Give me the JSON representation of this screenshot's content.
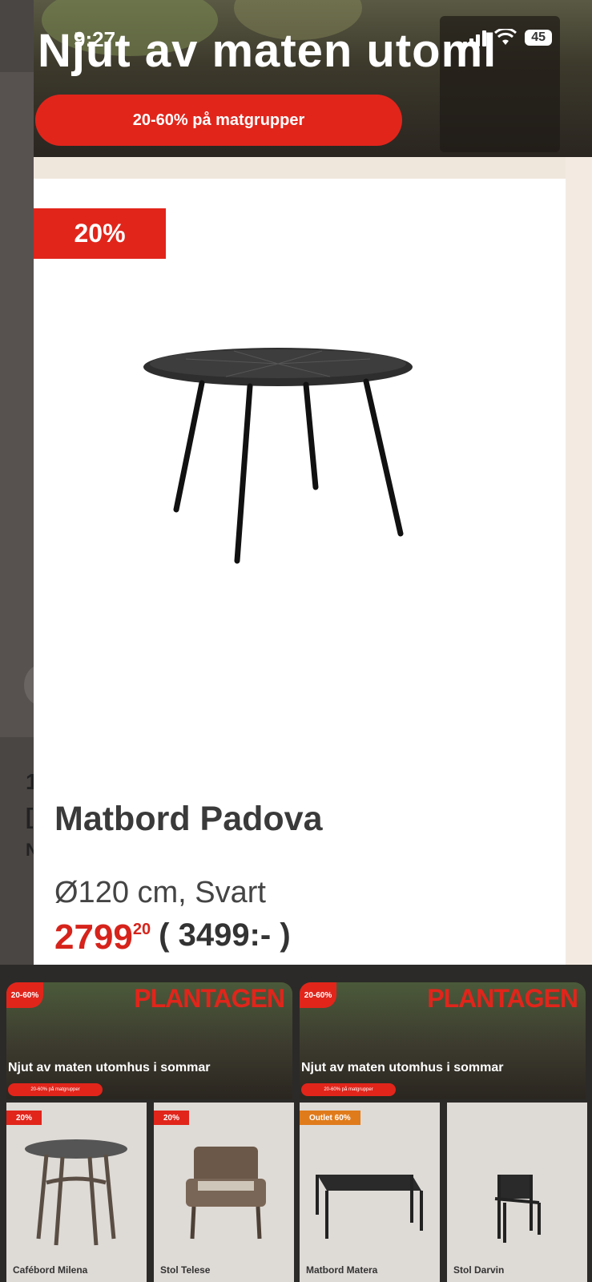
{
  "status_bar": {
    "time": "9:27",
    "battery": "45"
  },
  "banner": {
    "headline": "Njut av maten utoml",
    "promo_pill": "20-60% på matgrupper"
  },
  "product_card": {
    "discount_badge": "20%",
    "name": "Matbord Padova",
    "spec": "Ø120 cm, Svart",
    "price_main": "2799",
    "price_cents": "20",
    "price_old": "( 3499:- )"
  },
  "background_fragments": [
    "1",
    "[",
    "N"
  ],
  "promo_tiles": [
    {
      "badge": "20-60%",
      "brand": "PLANTAGEN",
      "headline": "Njut av maten utomhus i sommar",
      "pill": "20-60% på matgrupper"
    },
    {
      "badge": "20-60%",
      "brand": "PLANTAGEN",
      "headline": "Njut av maten utomhus i sommar",
      "pill": "20-60% på matgrupper"
    }
  ],
  "product_tiles": [
    {
      "badge": "20%",
      "badge_color": "#e1251b",
      "name": "Cafébord Milena"
    },
    {
      "badge": "20%",
      "badge_color": "#e1251b",
      "name": "Stol Telese"
    },
    {
      "badge": "Outlet 60%",
      "badge_color": "#e07b1b",
      "name": "Matbord Matera"
    },
    {
      "badge": "",
      "badge_color": "",
      "name": "Stol Darvin"
    }
  ],
  "colors": {
    "brand_red": "#e1251b",
    "outlet_orange": "#e07b1b"
  }
}
